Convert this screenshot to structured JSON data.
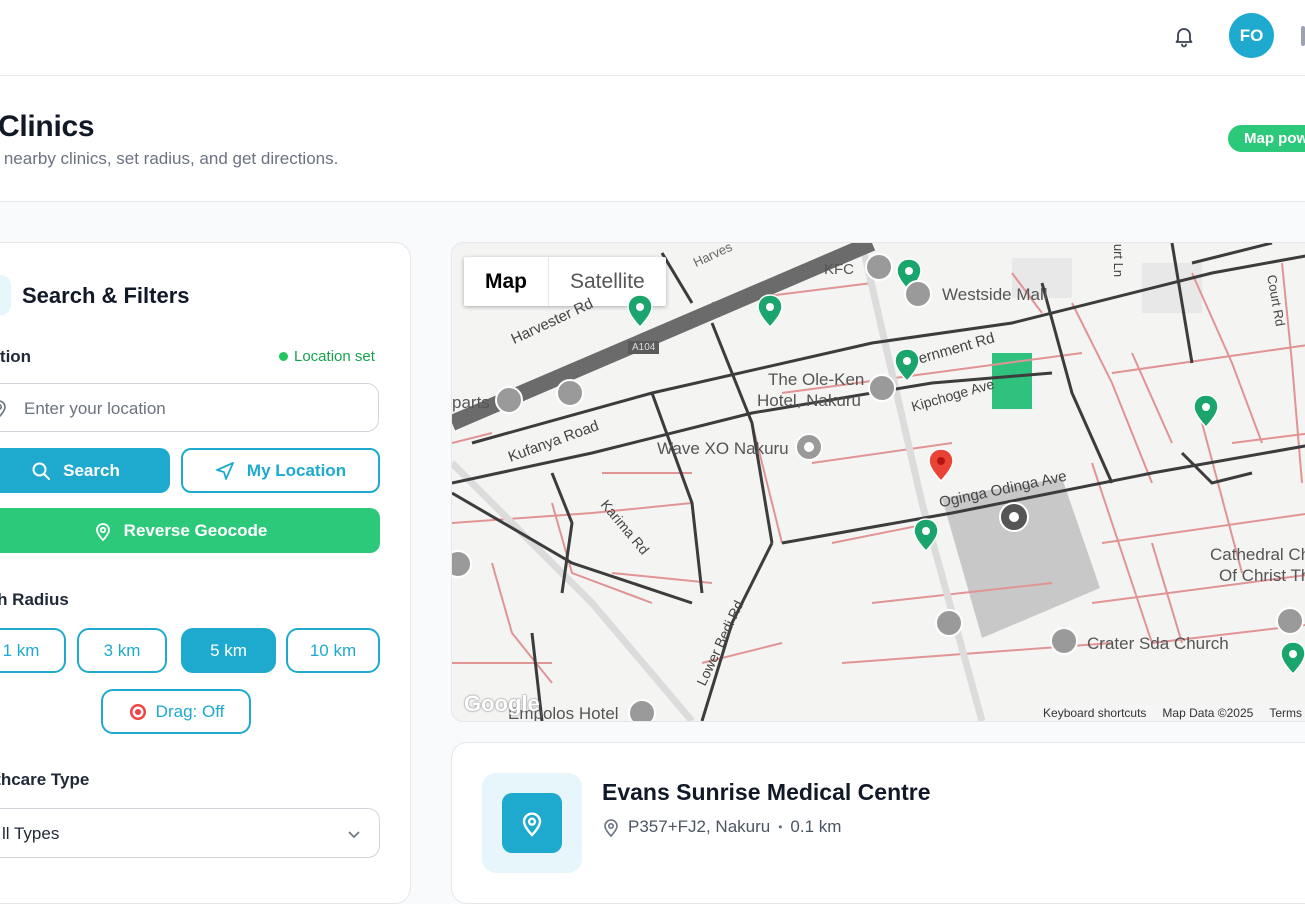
{
  "topbar": {
    "avatar_initials": "FO"
  },
  "header": {
    "title": "Clinics",
    "subtitle": "er nearby clinics, set radius, and get directions.",
    "map_badge": "Map pow"
  },
  "filters": {
    "title": "Search & Filters",
    "location_label": "cation",
    "location_status": "Location set",
    "location_placeholder": "Enter your location",
    "search_button": "Search",
    "my_location_button": "My Location",
    "reverse_geocode_button": "Reverse Geocode",
    "radius_label": "rch Radius",
    "radius_options": [
      "1 km",
      "3 km",
      "5 km",
      "10 km"
    ],
    "radius_selected": "5 km",
    "drag_button": "Drag: Off",
    "healthcare_label": "althcare Type",
    "healthcare_value": "ll Types"
  },
  "map": {
    "toggle_map": "Map",
    "toggle_satellite": "Satellite",
    "footer": {
      "shortcuts": "Keyboard shortcuts",
      "data": "Map Data ©2025",
      "terms": "Terms"
    },
    "logo": "Google",
    "labels": {
      "harvester_rd": "Harvester Rd",
      "harves": "Harves",
      "a104": "A104",
      "kfc": "KFC",
      "westside_mall": "Westside Mall",
      "government_rd": "vernment Rd",
      "ole_ken_1": "The Ole-Ken",
      "ole_ken_2": "Hotel, Nakuru",
      "kipchoge_ave": "Kipchoge Ave",
      "parts": "parts",
      "kufanya_road": "Kufanya Road",
      "wave_xo": "Wave XO Nakuru",
      "oginga_ave": "Oginga Odinga Ave",
      "karima_rd": "Karima Rd",
      "lower_bedi_rd": "Lower Bedi Rd",
      "cathedral_1": "Cathedral Ch",
      "cathedral_2": "Of Christ The",
      "crater_church": "Crater Sda Church",
      "empolos_hotel": "Empolos Hotel",
      "court_rd": "Court Rd",
      "court_ln": "urt Ln"
    }
  },
  "clinic_card": {
    "name": "Evans Sunrise Medical Centre",
    "address": "P357+FJ2, Nakuru",
    "distance": "0.1 km"
  }
}
